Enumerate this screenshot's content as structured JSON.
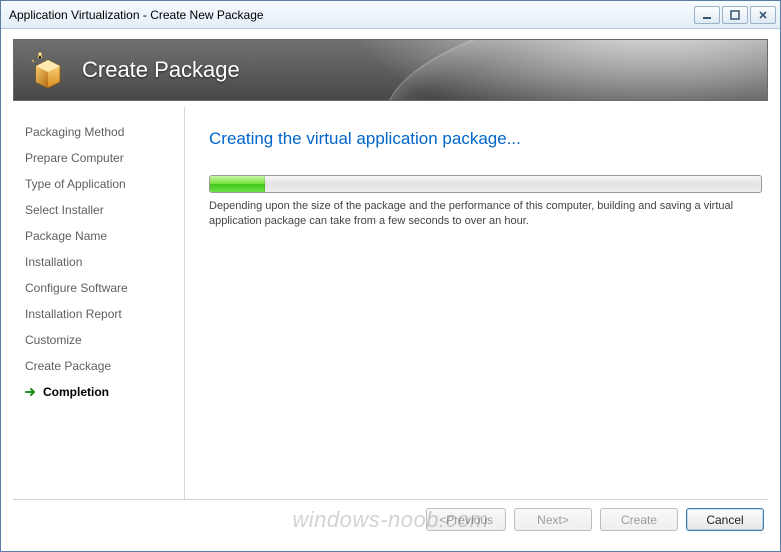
{
  "window": {
    "title": "Application Virtualization - Create New Package"
  },
  "header": {
    "title": "Create Package"
  },
  "sidebar": {
    "steps": [
      {
        "label": "Packaging Method",
        "active": false
      },
      {
        "label": "Prepare Computer",
        "active": false
      },
      {
        "label": "Type of Application",
        "active": false
      },
      {
        "label": "Select Installer",
        "active": false
      },
      {
        "label": "Package Name",
        "active": false
      },
      {
        "label": "Installation",
        "active": false
      },
      {
        "label": "Configure Software",
        "active": false
      },
      {
        "label": "Installation Report",
        "active": false
      },
      {
        "label": "Customize",
        "active": false
      },
      {
        "label": "Create Package",
        "active": false
      },
      {
        "label": "Completion",
        "active": true
      }
    ]
  },
  "content": {
    "heading": "Creating the virtual application package...",
    "progress_percent": 10,
    "note": "Depending upon the size of the package and the performance of this computer, building and saving a virtual application package can take from a few seconds to over an hour."
  },
  "footer": {
    "previous_label": "<Previous",
    "next_label": "Next>",
    "create_label": "Create",
    "cancel_label": "Cancel",
    "previous_enabled": false,
    "next_enabled": false,
    "create_enabled": false,
    "cancel_enabled": true
  },
  "watermark": "windows-noob.com"
}
